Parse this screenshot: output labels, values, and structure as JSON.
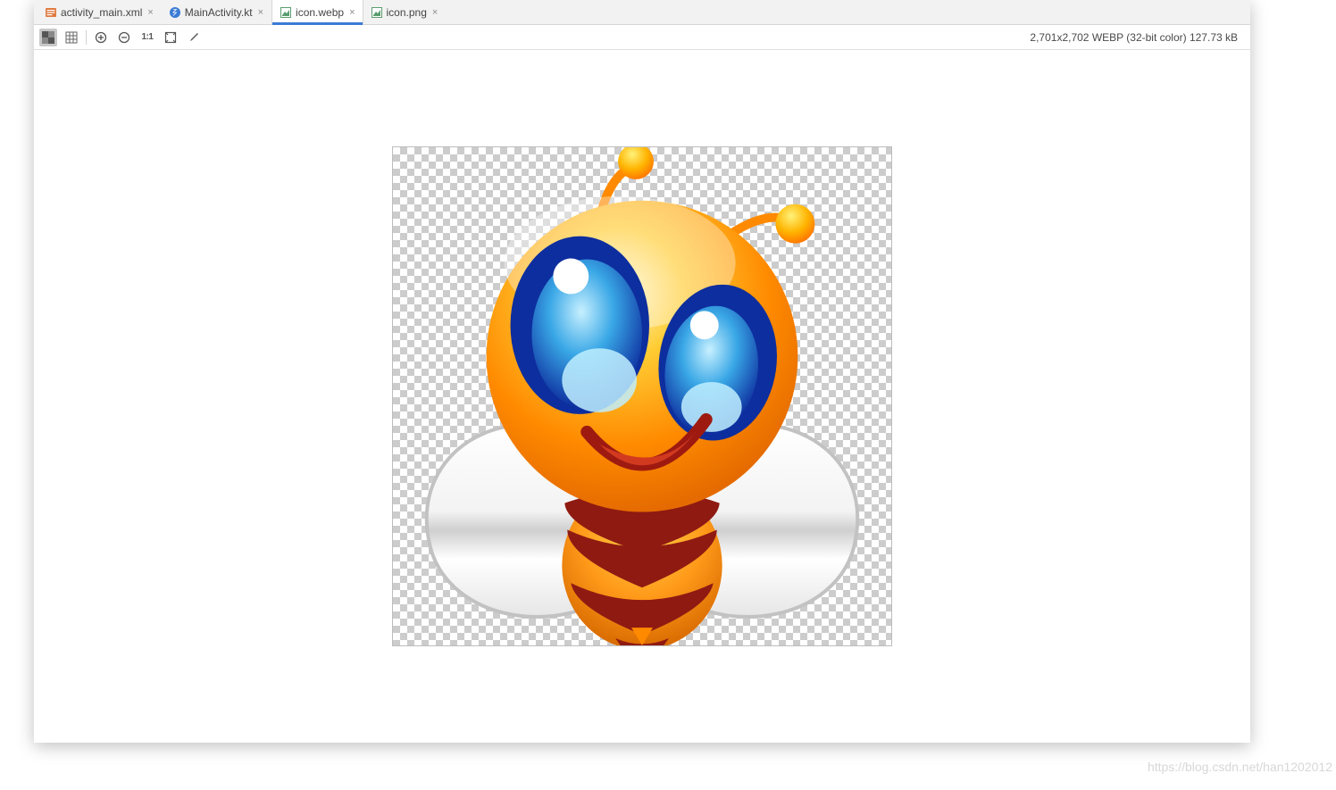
{
  "tabs": [
    {
      "label": "activity_main.xml",
      "icon": "xml-file-icon",
      "active": false
    },
    {
      "label": "MainActivity.kt",
      "icon": "kotlin-file-icon",
      "active": false
    },
    {
      "label": "icon.webp",
      "icon": "image-file-icon",
      "active": true
    },
    {
      "label": "icon.png",
      "icon": "image-file-icon",
      "active": false
    }
  ],
  "toolbar": {
    "one_to_one_label": "1:1"
  },
  "image_info": {
    "dimensions": "2,701x2,702",
    "format": "WEBP",
    "color_depth": "(32-bit color)",
    "size": "127.73 kB",
    "full_text": "2,701x2,702 WEBP (32-bit color) 127.73 kB"
  },
  "watermark": "https://blog.csdn.net/han1202012"
}
